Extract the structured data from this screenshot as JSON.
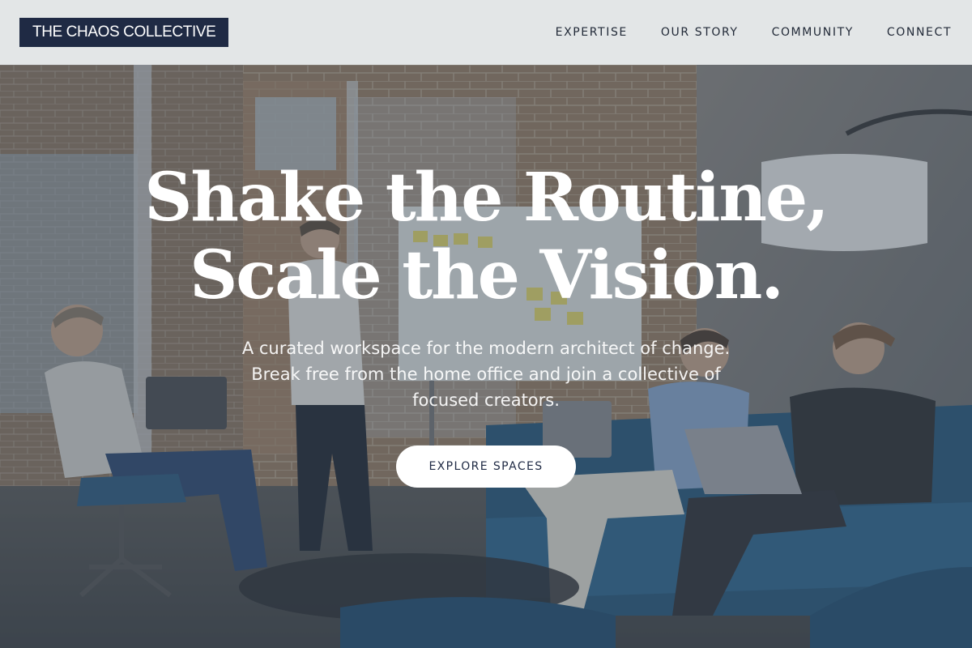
{
  "header": {
    "logo_text": "THE CHAOS COLLECTIVE",
    "nav": [
      {
        "label": "EXPERTISE"
      },
      {
        "label": "OUR STORY"
      },
      {
        "label": "COMMUNITY"
      },
      {
        "label": "CONNECT"
      }
    ]
  },
  "hero": {
    "title_lines": [
      "Shake the Routine,",
      "Scale the Vision."
    ],
    "subtitle_lines": [
      "A curated workspace for the modern architect of change.",
      "Break free from the home office and join a collective of",
      "focused creators."
    ],
    "cta_label": "EXPLORE SPACES",
    "background_image": "coworking-office-team-photo"
  },
  "colors": {
    "logo_bg": "#1f2a44",
    "nav_text": "#222a38",
    "header_bg": "#eceeee",
    "overlay": "#3a4858",
    "cta_bg": "#ffffff",
    "cta_text": "#1f2a44"
  }
}
